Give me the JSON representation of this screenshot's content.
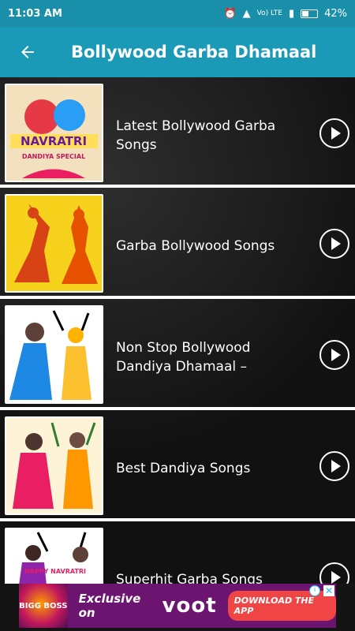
{
  "status": {
    "time": "11:03 AM",
    "network": "Vo) LTE",
    "battery": "42%"
  },
  "appbar": {
    "title": "Bollywood Garba Dhamaal",
    "back_icon": "arrow-back-icon"
  },
  "items": [
    {
      "label": "Latest Bollywood Garba Songs",
      "thumb_text": "NAVRATRI",
      "thumb_sub": "DANDIYA SPECIAL",
      "thumb_bg": "#f5e6c8"
    },
    {
      "label": "Garba Bollywood Songs",
      "thumb_bg": "#f6d21c"
    },
    {
      "label": "Non Stop Bollywood Dandiya Dhamaal –",
      "thumb_bg": "#ffffff"
    },
    {
      "label": "Best Dandiya Songs",
      "thumb_bg": "#fdf3d6"
    },
    {
      "label": "Superhit Garba Songs",
      "thumb_text": "HAPPY NAVRATRI",
      "thumb_bg": "#ffffff"
    }
  ],
  "ad": {
    "logo_text": "BIGG BOSS",
    "text": "Exclusive on",
    "brand": "voot",
    "cta": "DOWNLOAD THE APP",
    "info": "i",
    "close": "✕"
  },
  "colors": {
    "accent": "#1a9ab6",
    "status_bar": "#1a8faa",
    "ad_bg": "#6b1470",
    "cta": "#f04545"
  }
}
